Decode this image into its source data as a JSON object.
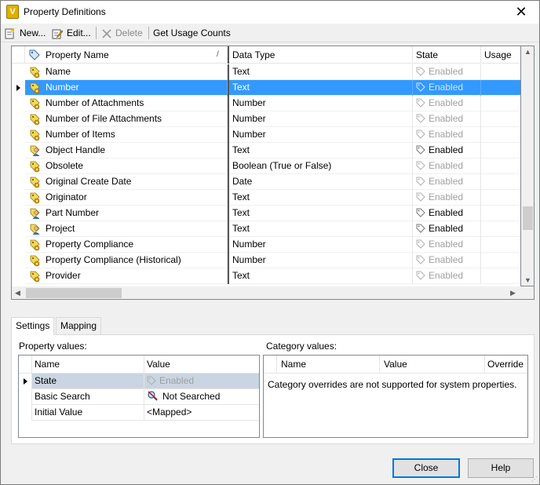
{
  "window": {
    "title": "Property Definitions",
    "app_icon_letter": "V"
  },
  "toolbar": {
    "new_label": "New...",
    "edit_label": "Edit...",
    "delete_label": "Delete",
    "usage_label": "Get Usage Counts"
  },
  "grid": {
    "columns": [
      "Property Name",
      "Data Type",
      "State",
      "Usage"
    ],
    "rows": [
      {
        "name": "Name",
        "type": "Text",
        "state": "Enabled",
        "enabled": false,
        "icon": "system-property-icon"
      },
      {
        "name": "Number",
        "type": "Text",
        "state": "Enabled",
        "enabled": false,
        "icon": "system-property-icon"
      },
      {
        "name": "Number of Attachments",
        "type": "Number",
        "state": "Enabled",
        "enabled": false,
        "icon": "system-property-icon"
      },
      {
        "name": "Number of File Attachments",
        "type": "Number",
        "state": "Enabled",
        "enabled": false,
        "icon": "system-property-icon"
      },
      {
        "name": "Number of Items",
        "type": "Number",
        "state": "Enabled",
        "enabled": false,
        "icon": "system-property-icon"
      },
      {
        "name": "Object Handle",
        "type": "Text",
        "state": "Enabled",
        "enabled": true,
        "icon": "user-property-icon"
      },
      {
        "name": "Obsolete",
        "type": "Boolean (True or False)",
        "state": "Enabled",
        "enabled": false,
        "icon": "system-property-icon"
      },
      {
        "name": "Original Create Date",
        "type": "Date",
        "state": "Enabled",
        "enabled": false,
        "icon": "system-property-icon"
      },
      {
        "name": "Originator",
        "type": "Text",
        "state": "Enabled",
        "enabled": false,
        "icon": "system-property-icon"
      },
      {
        "name": "Part Number",
        "type": "Text",
        "state": "Enabled",
        "enabled": true,
        "icon": "user-property-icon"
      },
      {
        "name": "Project",
        "type": "Text",
        "state": "Enabled",
        "enabled": true,
        "icon": "user-property-icon"
      },
      {
        "name": "Property Compliance",
        "type": "Number",
        "state": "Enabled",
        "enabled": false,
        "icon": "system-property-icon"
      },
      {
        "name": "Property Compliance (Historical)",
        "type": "Number",
        "state": "Enabled",
        "enabled": false,
        "icon": "system-property-icon"
      },
      {
        "name": "Provider",
        "type": "Text",
        "state": "Enabled",
        "enabled": false,
        "icon": "system-property-icon"
      }
    ]
  },
  "tabs": [
    "Settings",
    "Mapping"
  ],
  "property_values": {
    "label": "Property values:",
    "columns": [
      "Name",
      "Value"
    ],
    "rows": [
      {
        "name": "State",
        "value": "Enabled",
        "icon": "tag-icon"
      },
      {
        "name": "Basic Search",
        "value": "Not Searched",
        "icon": "not-searched-icon"
      },
      {
        "name": "Initial Value",
        "value": "<Mapped>",
        "icon": ""
      }
    ]
  },
  "category_values": {
    "label": "Category values:",
    "columns": [
      "Name",
      "Value",
      "Override"
    ],
    "message": "Category overrides are not supported for system properties."
  },
  "buttons": {
    "close_label": "Close",
    "help_label": "Help"
  }
}
